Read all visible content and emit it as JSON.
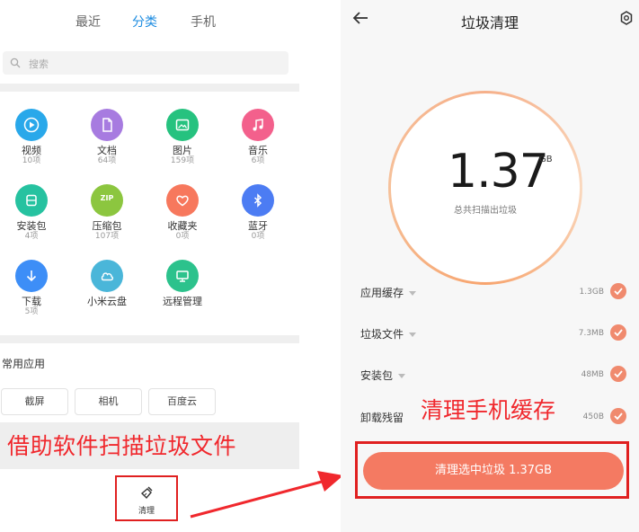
{
  "file_manager": {
    "tabs": [
      {
        "label": "最近",
        "active": false
      },
      {
        "label": "分类",
        "active": true
      },
      {
        "label": "手机",
        "active": false
      }
    ],
    "search": {
      "placeholder": "搜索"
    },
    "categories": [
      {
        "label": "视频",
        "count": "10项",
        "color": "#29a8ea",
        "icon": "play-icon"
      },
      {
        "label": "文档",
        "count": "64项",
        "color": "#a77be0",
        "icon": "document-icon"
      },
      {
        "label": "图片",
        "count": "159项",
        "color": "#26c27f",
        "icon": "image-icon"
      },
      {
        "label": "音乐",
        "count": "6项",
        "color": "#f3608c",
        "icon": "music-icon"
      },
      {
        "label": "安装包",
        "count": "4项",
        "color": "#26c2a0",
        "icon": "package-icon"
      },
      {
        "label": "压缩包",
        "count": "107项",
        "color": "#8cc63f",
        "icon": "zip-icon"
      },
      {
        "label": "收藏夹",
        "count": "0项",
        "color": "#f7785d",
        "icon": "heart-icon"
      },
      {
        "label": "蓝牙",
        "count": "0项",
        "color": "#4c7cf3",
        "icon": "bluetooth-icon"
      },
      {
        "label": "下载",
        "count": "5项",
        "color": "#3d8ef7",
        "icon": "download-icon"
      },
      {
        "label": "小米云盘",
        "count": "",
        "color": "#4ab6d9",
        "icon": "cloud-icon"
      },
      {
        "label": "远程管理",
        "count": "",
        "color": "#2cc28c",
        "icon": "remote-icon"
      }
    ],
    "zip_badge": "ZIP",
    "frequent_apps_title": "常用应用",
    "frequent_apps": [
      "截屏",
      "相机",
      "百度云"
    ],
    "caption": "借助软件扫描垃圾文件",
    "clean_button_label": "清理"
  },
  "cleaner": {
    "title": "垃圾清理",
    "total_value": "1.37",
    "total_unit": "GB",
    "subtitle": "总共扫描出垃圾",
    "items": [
      {
        "label": "应用缓存",
        "size": "1.3GB",
        "checked": true
      },
      {
        "label": "垃圾文件",
        "size": "7.3MB",
        "checked": true
      },
      {
        "label": "安装包",
        "size": "48MB",
        "checked": true
      },
      {
        "label": "卸载残留",
        "size": "450B",
        "checked": true
      }
    ],
    "overlay_note": "清理手机缓存",
    "clean_button": "清理选中垃圾  1.37GB"
  },
  "colors": {
    "accent": "#1b8be0",
    "annotation_red": "#f0282d",
    "button": "#f47a62",
    "check": "#f08a6e"
  }
}
